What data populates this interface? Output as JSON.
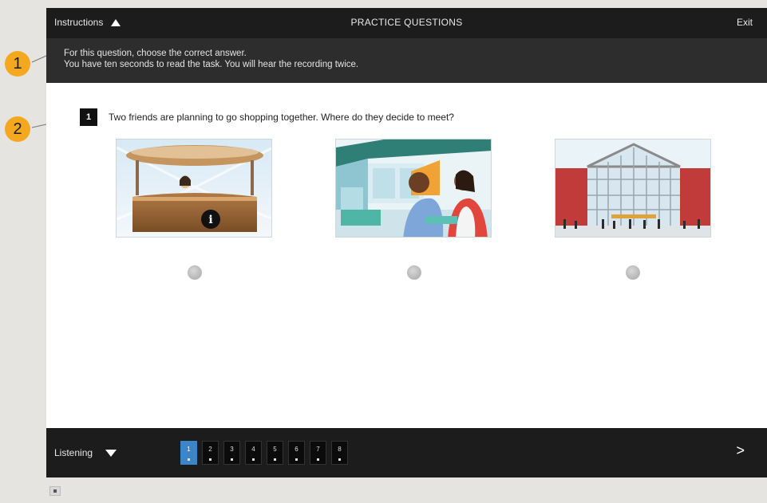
{
  "header": {
    "instructions_label": "Instructions",
    "title": "PRACTICE QUESTIONS",
    "exit_label": "Exit"
  },
  "instructions": {
    "line1": "For this question, choose the correct answer.",
    "line2": "You have ten seconds to read the task. You will hear the recording twice."
  },
  "question": {
    "number": "1",
    "text": "Two friends are planning to go shopping together. Where do they decide to meet?",
    "options": [
      {
        "image": "information-desk"
      },
      {
        "image": "cafe-friends"
      },
      {
        "image": "shopping-mall-entrance"
      }
    ]
  },
  "footer": {
    "section_label": "Listening",
    "question_numbers": [
      "1",
      "2",
      "3",
      "4",
      "5",
      "6",
      "7",
      "8"
    ],
    "active_question": "1",
    "next_label": ">"
  },
  "callouts": [
    "1",
    "2"
  ],
  "colors": {
    "bar_dark": "#1c1c1c",
    "instructions_bg": "#2d2d2d",
    "active_nav": "#3a86c8",
    "callout": "#f4a81f"
  }
}
